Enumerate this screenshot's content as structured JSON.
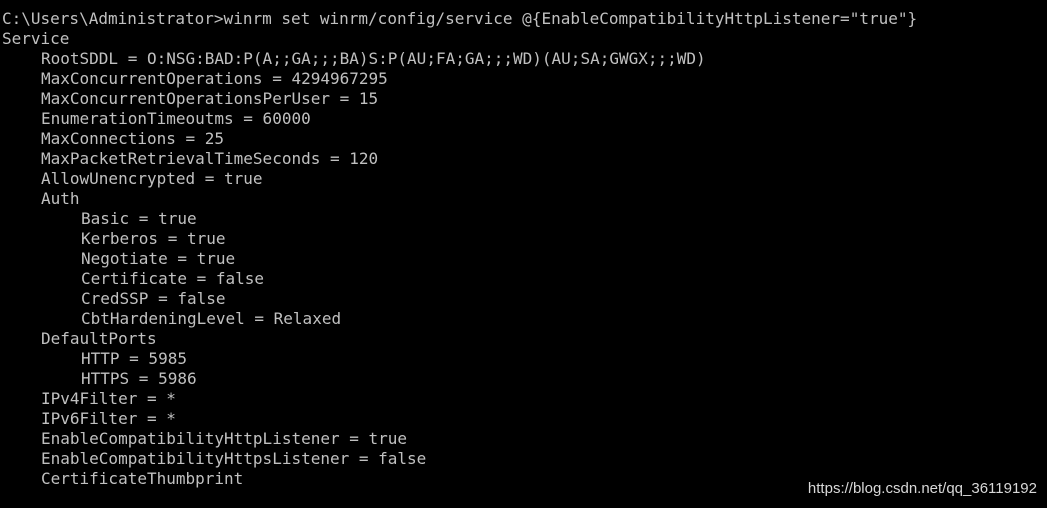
{
  "console": {
    "command_line": "C:\\Users\\Administrator>winrm set winrm/config/service @{EnableCompatibilityHttpListener=\"true\"}",
    "output_header": "Service",
    "settings": [
      "RootSDDL = O:NSG:BAD:P(A;;GA;;;BA)S:P(AU;FA;GA;;;WD)(AU;SA;GWGX;;;WD)",
      "MaxConcurrentOperations = 4294967295",
      "MaxConcurrentOperationsPerUser = 15",
      "EnumerationTimeoutms = 60000",
      "MaxConnections = 25",
      "MaxPacketRetrievalTimeSeconds = 120",
      "AllowUnencrypted = true"
    ],
    "auth": {
      "header": "Auth",
      "items": [
        "Basic = true",
        "Kerberos = true",
        "Negotiate = true",
        "Certificate = false",
        "CredSSP = false",
        "CbtHardeningLevel = Relaxed"
      ]
    },
    "default_ports": {
      "header": "DefaultPorts",
      "items": [
        "HTTP = 5985",
        "HTTPS = 5986"
      ]
    },
    "trailing_settings": [
      "IPv4Filter = *",
      "IPv6Filter = *",
      "EnableCompatibilityHttpListener = true",
      "EnableCompatibilityHttpsListener = false",
      "CertificateThumbprint"
    ]
  },
  "watermark": "https://blog.csdn.net/qq_36119192",
  "colors": {
    "background": "#000000",
    "text": "#c0c0c0"
  }
}
